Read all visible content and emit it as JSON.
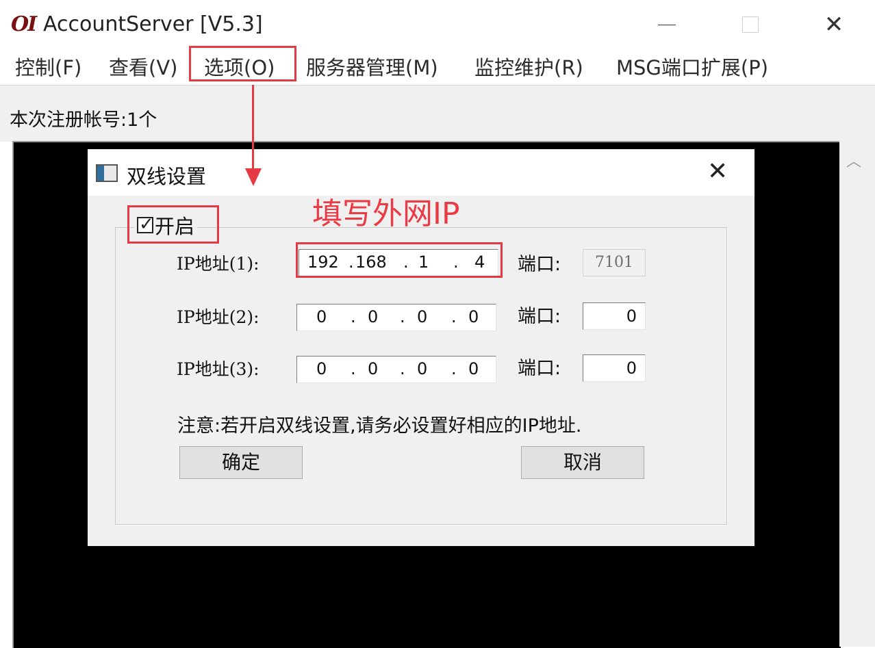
{
  "window": {
    "logo": "OI",
    "title": "AccountServer [V5.3]"
  },
  "menu": {
    "items": [
      {
        "label": "控制(F)"
      },
      {
        "label": "查看(V)"
      },
      {
        "label": "选项(O)"
      },
      {
        "label": "服务器管理(M)"
      },
      {
        "label": "监控维护(R)"
      },
      {
        "label": "MSG端口扩展(P)"
      }
    ]
  },
  "status": {
    "register_count": "本次注册帐号:1个"
  },
  "dialog": {
    "title": "双线设置",
    "enable": {
      "label": "开启",
      "checked": true
    },
    "rows": [
      {
        "label": "IP地址(1):",
        "octets": [
          "192",
          "168",
          "1",
          "4"
        ],
        "port_label": "端口:",
        "port": "7101",
        "port_enabled": false
      },
      {
        "label": "IP地址(2):",
        "octets": [
          "0",
          "0",
          "0",
          "0"
        ],
        "port_label": "端口:",
        "port": "0",
        "port_enabled": true
      },
      {
        "label": "IP地址(3):",
        "octets": [
          "0",
          "0",
          "0",
          "0"
        ],
        "port_label": "端口:",
        "port": "0",
        "port_enabled": true
      }
    ],
    "note": "注意:若开启双线设置,请务必设置好相应的IP地址.",
    "ok_label": "确定",
    "cancel_label": "取消"
  },
  "annotation": {
    "text": "填写外网IP",
    "color": "#e53a43"
  },
  "icons": {
    "minimize": "minimize-icon",
    "maximize": "maximize-icon",
    "close": "close-icon",
    "dialog": "dialog-window-icon",
    "checkmark": "checkmark-icon",
    "scroll_up": "chevron-up-icon"
  }
}
